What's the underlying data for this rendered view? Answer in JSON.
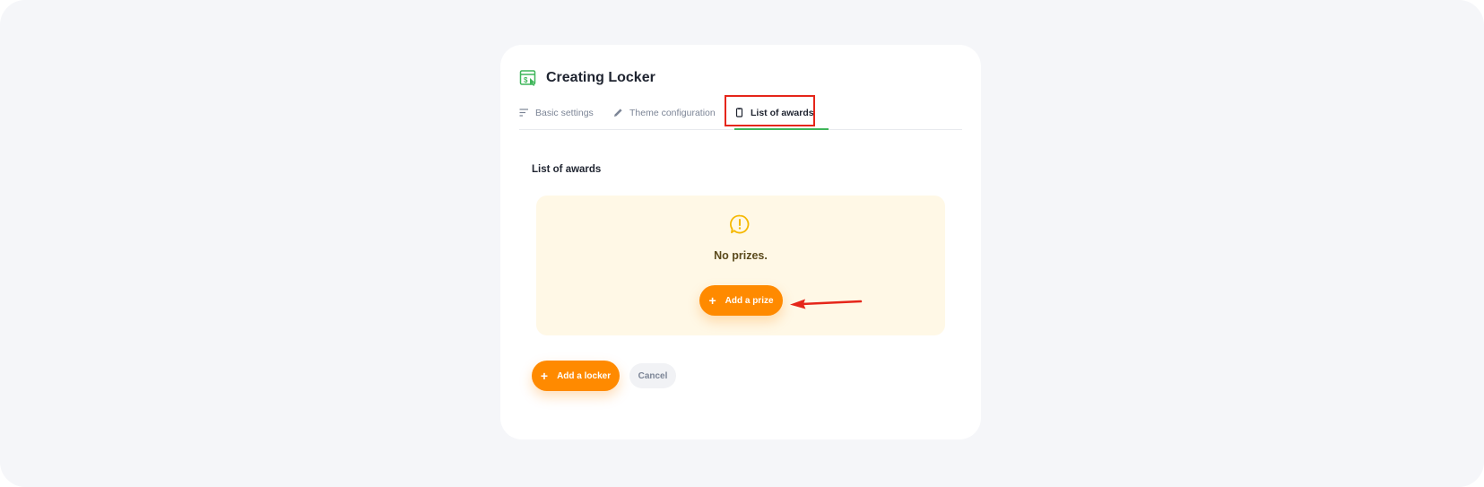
{
  "header": {
    "title": "Creating Locker",
    "icon": "locker-dollar-icon"
  },
  "tabs": [
    {
      "label": "Basic settings",
      "icon": "sort-lines-icon",
      "active": false
    },
    {
      "label": "Theme configuration",
      "icon": "pencil-icon",
      "active": false
    },
    {
      "label": "List of awards",
      "icon": "clipboard-icon",
      "active": true
    }
  ],
  "section": {
    "title": "List of awards"
  },
  "empty_state": {
    "icon": "alert-circle-icon",
    "message": "No prizes.",
    "button_label": "Add a prize"
  },
  "actions": {
    "add_locker_label": "Add a locker",
    "cancel_label": "Cancel"
  },
  "colors": {
    "accent": "#ff8a00",
    "active_tab_underline": "#3fb65a",
    "empty_panel_bg": "#fff8e6",
    "annotation_red": "#e5261a",
    "alert_icon": "#f5b800"
  }
}
